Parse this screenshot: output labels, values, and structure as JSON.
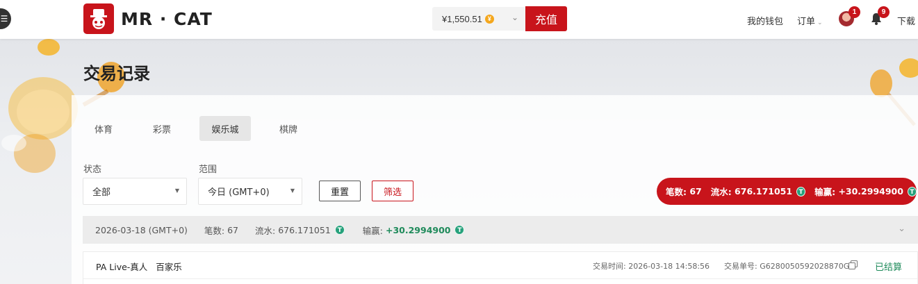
{
  "header": {
    "brand": "MR · CAT",
    "balance": "¥1,550.51",
    "balance_currency_icon": "coin-icon",
    "deposit_label": "充值",
    "wallet_label": "我的钱包",
    "orders_label": "订单",
    "avatar_badge": "1",
    "notification_badge": "9",
    "download_label": "下载"
  },
  "page": {
    "title": "交易记录"
  },
  "tabs": [
    {
      "label": "体育",
      "active": false
    },
    {
      "label": "彩票",
      "active": false
    },
    {
      "label": "娱乐城",
      "active": true
    },
    {
      "label": "棋牌",
      "active": false
    }
  ],
  "filters": {
    "status_label": "状态",
    "status_value": "全部",
    "range_label": "范围",
    "range_value": "今日 (GMT+0)",
    "reset_label": "重置",
    "filter_label": "筛选"
  },
  "summary": {
    "count_label": "笔数:",
    "count_value": "67",
    "turnover_label": "流水:",
    "turnover_value": "676.171051",
    "winloss_label": "输赢:",
    "winloss_value": "+30.2994900"
  },
  "day_group": {
    "date": "2026-03-18 (GMT+0)",
    "count_label": "笔数:",
    "count_value": "67",
    "turnover_label": "流水:",
    "turnover_value": "676.171051",
    "winloss_label": "输赢:",
    "winloss_value": "+30.2994900"
  },
  "record": {
    "game": "PA Live-真人",
    "game_type": "百家乐",
    "time_label": "交易时间:",
    "time_value": "2026-03-18 14:58:56",
    "order_label": "交易单号:",
    "order_value": "G6280050592028870G",
    "status": "已结算"
  },
  "colors": {
    "brand_red": "#c8141b",
    "positive_green": "#1e8a5a",
    "tether_green": "#26a17b"
  }
}
